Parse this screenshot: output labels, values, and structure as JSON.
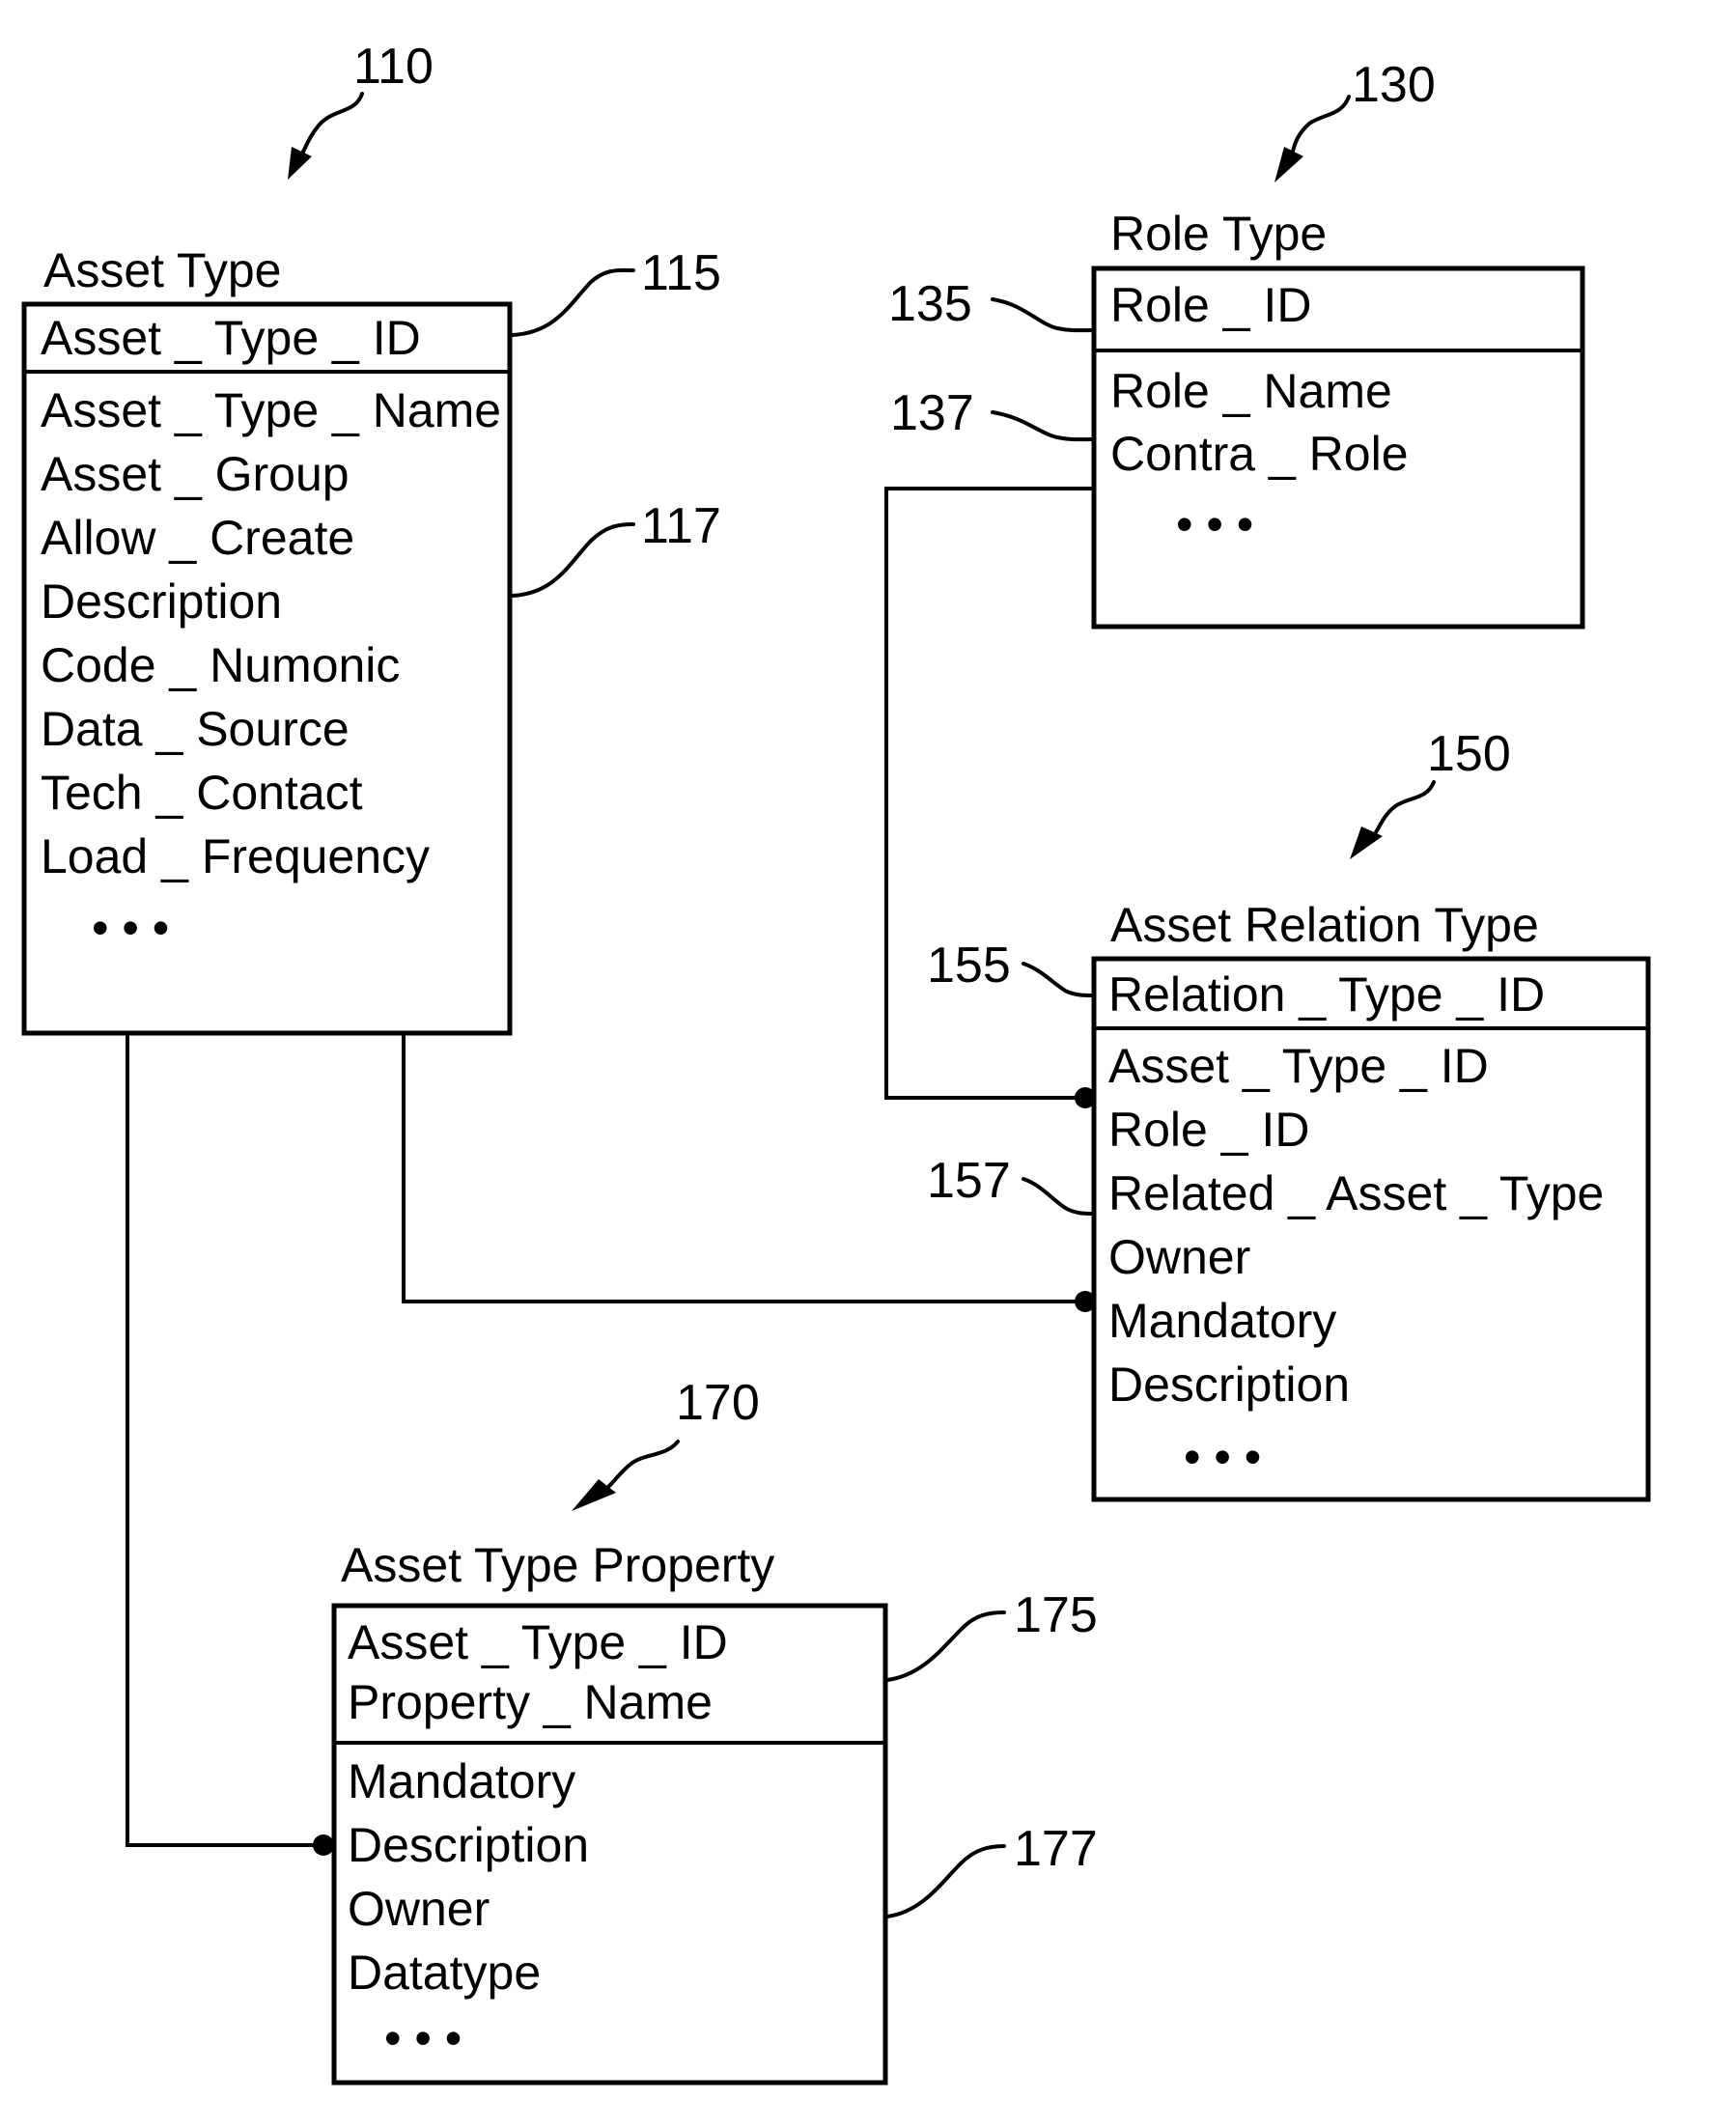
{
  "figure": {
    "entities": [
      {
        "id": "asset_type",
        "ref": "110",
        "title": "Asset Type",
        "key_ref": "115",
        "attr_ref": "117",
        "key_fields": [
          "Asset _ Type _ ID"
        ],
        "fields": [
          "Asset _ Type _ Name",
          "Asset _ Group",
          "Allow _ Create",
          "Description",
          "Code _ Numonic",
          "Data _ Source",
          "Tech _ Contact",
          "Load _ Frequency"
        ],
        "ellipsis": "• • •"
      },
      {
        "id": "role_type",
        "ref": "130",
        "title": "Role  Type",
        "key_ref": "135",
        "attr_ref": "137",
        "key_fields": [
          "Role _ ID"
        ],
        "fields": [
          "Role _ Name",
          "Contra _ Role"
        ],
        "ellipsis": "• • •"
      },
      {
        "id": "asset_relation_type",
        "ref": "150",
        "title": "Asset  Relation  Type",
        "key_ref": "155",
        "attr_ref": "157",
        "key_fields": [
          "Relation _ Type _ ID"
        ],
        "fields": [
          "Asset _ Type _ ID",
          "Role _ ID",
          "Related _ Asset _ Type",
          "Owner",
          "Mandatory",
          "Description"
        ],
        "ellipsis": "• • •"
      },
      {
        "id": "asset_type_property",
        "ref": "170",
        "title": "Asset  Type  Property",
        "key_ref": "175",
        "attr_ref": "177",
        "key_fields": [
          "Asset _ Type _ ID",
          "Property _ Name"
        ],
        "fields": [
          "Mandatory",
          "Description",
          "Owner",
          "Datatype"
        ],
        "ellipsis": "• • •"
      }
    ],
    "relationships": [
      {
        "from": "role_type",
        "to": "asset_relation_type",
        "to_field": "Asset _ Type _ ID"
      },
      {
        "from": "asset_type",
        "to": "asset_relation_type",
        "to_field": "Mandatory"
      },
      {
        "from": "asset_type",
        "to": "asset_type_property",
        "to_field": "Description"
      }
    ]
  }
}
